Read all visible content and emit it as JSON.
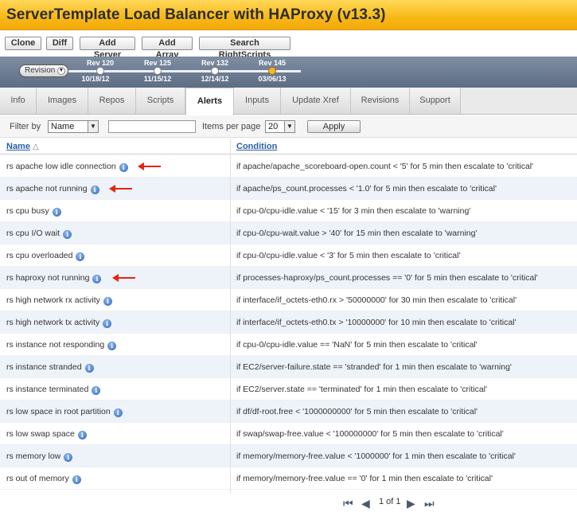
{
  "window": {
    "title": "ServerTemplate Load Balancer with HAProxy (v13.3)"
  },
  "actions": [
    "Clone",
    "Diff",
    "Add Server",
    "Add Array",
    "Search RightScripts"
  ],
  "revision": {
    "selector_label": "Revision",
    "revisions": [
      {
        "rev": "Rev 120",
        "date": "10/18/12"
      },
      {
        "rev": "Rev 125",
        "date": "11/15/12"
      },
      {
        "rev": "Rev 132",
        "date": "12/14/12"
      },
      {
        "rev": "Rev 145",
        "date": "03/06/13",
        "current": true
      }
    ]
  },
  "tabs": [
    "Info",
    "Images",
    "Repos",
    "Scripts",
    "Alerts",
    "Inputs",
    "Update Xref",
    "Revisions",
    "Support"
  ],
  "active_tab": "Alerts",
  "filter": {
    "filter_by_label": "Filter by",
    "filter_by_value": "Name",
    "search_value": "",
    "items_per_page_label": "Items per page",
    "items_per_page_value": "20",
    "apply_label": "Apply"
  },
  "table": {
    "columns": [
      "Name",
      "Condition"
    ],
    "sort_indicator": "△",
    "rows": [
      {
        "name": "rs apache low idle connection",
        "condition": "if apache/apache_scoreboard-open.count < '5' for 5 min then escalate to 'critical'",
        "highlighted": true
      },
      {
        "name": "rs apache not running",
        "condition": "if apache/ps_count.processes < '1.0' for 5 min then escalate to 'critical'",
        "highlighted": true
      },
      {
        "name": "rs cpu busy",
        "condition": "if cpu-0/cpu-idle.value < '15' for 3 min then escalate to 'warning'"
      },
      {
        "name": "rs cpu I/O wait",
        "condition": "if cpu-0/cpu-wait.value > '40' for 15 min then escalate to 'warning'"
      },
      {
        "name": "rs cpu overloaded",
        "condition": "if cpu-0/cpu-idle.value < '3' for 5 min then escalate to 'critical'"
      },
      {
        "name": "rs haproxy not running",
        "condition": "if processes-haproxy/ps_count.processes == '0' for 5 min then escalate to 'critical'",
        "highlighted": true
      },
      {
        "name": "rs high network rx activity",
        "condition": "if interface/if_octets-eth0.rx > '50000000' for 30 min then escalate to 'critical'"
      },
      {
        "name": "rs high network tx activity",
        "condition": "if interface/if_octets-eth0.tx > '10000000' for 10 min then escalate to 'critical'"
      },
      {
        "name": "rs instance not responding",
        "condition": "if cpu-0/cpu-idle.value == 'NaN' for 5 min then escalate to 'critical'"
      },
      {
        "name": "rs instance stranded",
        "condition": "if EC2/server-failure.state == 'stranded' for 1 min then escalate to 'warning'"
      },
      {
        "name": "rs instance terminated",
        "condition": "if EC2/server.state == 'terminated' for 1 min then escalate to 'critical'"
      },
      {
        "name": "rs low space in root partition",
        "condition": "if df/df-root.free < '1000000000' for 5 min then escalate to 'critical'"
      },
      {
        "name": "rs low swap space",
        "condition": "if swap/swap-free.value < '100000000' for 5 min then escalate to 'critical'"
      },
      {
        "name": "rs memory low",
        "condition": "if memory/memory-free.value < '1000000' for 1 min then escalate to 'critical'"
      },
      {
        "name": "rs out of memory",
        "condition": "if memory/memory-free.value == '0' for 1 min then escalate to 'critical'"
      }
    ]
  },
  "pager": {
    "text": "1 of 1"
  },
  "colors": {
    "accent": "#f7b814",
    "link": "#2a5fa8",
    "annotation_arrow": "#e52412",
    "row_alt": "#eef3fa"
  }
}
